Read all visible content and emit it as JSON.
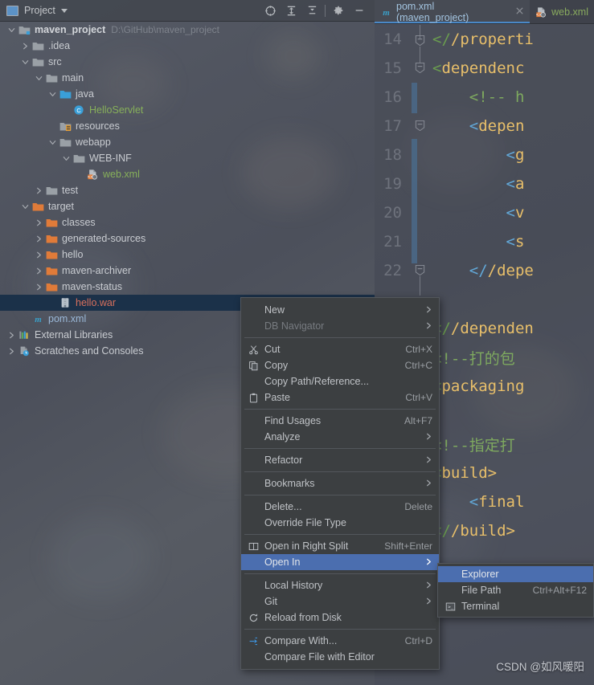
{
  "project_panel": {
    "header": {
      "title": "Project",
      "window_icon": "project-window-icon",
      "caret_icon": "chevron-down-icon",
      "toolbar": [
        {
          "name": "select-opened-file-icon",
          "label": "Select Opened File"
        },
        {
          "name": "expand-all-icon",
          "label": "Expand All"
        },
        {
          "name": "collapse-all-icon",
          "label": "Collapse All"
        },
        {
          "name": "gear-icon",
          "label": "Options"
        },
        {
          "name": "minimize-icon",
          "label": "Hide"
        }
      ]
    },
    "tree": [
      {
        "label": "maven_project",
        "hint": "D:\\GitHub\\maven_project",
        "indent": 0,
        "arrow": "down",
        "icon": "module-folder-icon",
        "style": "bold",
        "selected": false
      },
      {
        "label": ".idea",
        "hint": "",
        "indent": 1,
        "arrow": "right",
        "icon": "folder-icon",
        "style": "plain",
        "selected": false
      },
      {
        "label": "src",
        "hint": "",
        "indent": 1,
        "arrow": "down",
        "icon": "folder-icon",
        "style": "plain",
        "selected": false
      },
      {
        "label": "main",
        "hint": "",
        "indent": 2,
        "arrow": "down",
        "icon": "folder-icon",
        "style": "plain",
        "selected": false
      },
      {
        "label": "java",
        "hint": "",
        "indent": 3,
        "arrow": "down",
        "icon": "sources-folder-icon",
        "style": "plain",
        "selected": false
      },
      {
        "label": "HelloServlet",
        "hint": "",
        "indent": 4,
        "arrow": "none",
        "icon": "java-class-icon",
        "style": "green",
        "selected": false
      },
      {
        "label": "resources",
        "hint": "",
        "indent": 3,
        "arrow": "none",
        "icon": "resources-folder-icon",
        "style": "plain",
        "selected": false
      },
      {
        "label": "webapp",
        "hint": "",
        "indent": 3,
        "arrow": "down",
        "icon": "folder-icon",
        "style": "plain",
        "selected": false
      },
      {
        "label": "WEB-INF",
        "hint": "",
        "indent": 4,
        "arrow": "down",
        "icon": "folder-icon",
        "style": "plain",
        "selected": false
      },
      {
        "label": "web.xml",
        "hint": "",
        "indent": 5,
        "arrow": "none",
        "icon": "web-xml-icon",
        "style": "green",
        "selected": false
      },
      {
        "label": "test",
        "hint": "",
        "indent": 2,
        "arrow": "right",
        "icon": "folder-icon",
        "style": "plain",
        "selected": false
      },
      {
        "label": "target",
        "hint": "",
        "indent": 1,
        "arrow": "down",
        "icon": "excluded-folder-icon",
        "style": "plain",
        "selected": false
      },
      {
        "label": "classes",
        "hint": "",
        "indent": 2,
        "arrow": "right",
        "icon": "excluded-folder-icon",
        "style": "plain",
        "selected": false
      },
      {
        "label": "generated-sources",
        "hint": "",
        "indent": 2,
        "arrow": "right",
        "icon": "excluded-folder-icon",
        "style": "plain",
        "selected": false
      },
      {
        "label": "hello",
        "hint": "",
        "indent": 2,
        "arrow": "right",
        "icon": "excluded-folder-icon",
        "style": "plain",
        "selected": false
      },
      {
        "label": "maven-archiver",
        "hint": "",
        "indent": 2,
        "arrow": "right",
        "icon": "excluded-folder-icon",
        "style": "plain",
        "selected": false
      },
      {
        "label": "maven-status",
        "hint": "",
        "indent": 2,
        "arrow": "right",
        "icon": "excluded-folder-icon",
        "style": "plain",
        "selected": false
      },
      {
        "label": "hello.war",
        "hint": "",
        "indent": 3,
        "arrow": "none",
        "icon": "archive-icon",
        "style": "orange-red",
        "selected": true
      },
      {
        "label": "pom.xml",
        "hint": "",
        "indent": 1,
        "arrow": "none",
        "icon": "maven-icon",
        "style": "blue",
        "selected": false
      },
      {
        "label": "External Libraries",
        "hint": "",
        "indent": 0,
        "arrow": "right",
        "icon": "libraries-icon",
        "style": "plain",
        "selected": false
      },
      {
        "label": "Scratches and Consoles",
        "hint": "",
        "indent": 0,
        "arrow": "right",
        "icon": "scratches-icon",
        "style": "plain",
        "selected": false
      }
    ]
  },
  "editor": {
    "tabs": [
      {
        "label": "pom.xml (maven_project)",
        "icon": "maven-icon",
        "active": true,
        "closable": true,
        "close_icon": "close-icon",
        "style": "blue"
      },
      {
        "label": "web.xml",
        "icon": "web-xml-icon",
        "active": false,
        "closable": false,
        "close_icon": "",
        "style": "green"
      }
    ],
    "lines": [
      {
        "num": "14",
        "text": "</properti"
      },
      {
        "num": "15",
        "text": "<dependenc"
      },
      {
        "num": "16",
        "text": "    <!-- h"
      },
      {
        "num": "17",
        "text": "    <depen"
      },
      {
        "num": "18",
        "text": "        <g"
      },
      {
        "num": "19",
        "text": "        <a"
      },
      {
        "num": "20",
        "text": "        <v"
      },
      {
        "num": "21",
        "text": "        <s"
      },
      {
        "num": "22",
        "text": "    </depe"
      },
      {
        "num": "",
        "text": ""
      },
      {
        "num": "",
        "text": "</dependen"
      },
      {
        "num": "",
        "text": "<!--打的包"
      },
      {
        "num": "",
        "text": "<packaging"
      },
      {
        "num": "",
        "text": ""
      },
      {
        "num": "",
        "text": "<!--指定打"
      },
      {
        "num": "",
        "text": "<build>"
      },
      {
        "num": "",
        "text": "    <final"
      },
      {
        "num": "",
        "text": "</build>"
      }
    ]
  },
  "context_menu": {
    "items": [
      {
        "label": "New",
        "mnemonic": "",
        "accel": "",
        "icon": "",
        "submenu": true,
        "disabled": false,
        "highlighted": false
      },
      {
        "label": "DB Navigator",
        "mnemonic": "",
        "accel": "",
        "icon": "",
        "submenu": true,
        "disabled": true,
        "highlighted": false
      },
      {
        "separator": true
      },
      {
        "label": "Cut",
        "mnemonic": "t",
        "accel": "Ctrl+X",
        "icon": "cut-icon",
        "submenu": false,
        "disabled": false,
        "highlighted": false
      },
      {
        "label": "Copy",
        "mnemonic": "C",
        "accel": "Ctrl+C",
        "icon": "copy-icon",
        "submenu": false,
        "disabled": false,
        "highlighted": false
      },
      {
        "label": "Copy Path/Reference...",
        "mnemonic": "",
        "accel": "",
        "icon": "",
        "submenu": false,
        "disabled": false,
        "highlighted": false
      },
      {
        "label": "Paste",
        "mnemonic": "P",
        "accel": "Ctrl+V",
        "icon": "paste-icon",
        "submenu": false,
        "disabled": false,
        "highlighted": false
      },
      {
        "separator": true
      },
      {
        "label": "Find Usages",
        "mnemonic": "U",
        "accel": "Alt+F7",
        "icon": "",
        "submenu": false,
        "disabled": false,
        "highlighted": false
      },
      {
        "label": "Analyze",
        "mnemonic": "z",
        "accel": "",
        "icon": "",
        "submenu": true,
        "disabled": false,
        "highlighted": false
      },
      {
        "separator": true
      },
      {
        "label": "Refactor",
        "mnemonic": "R",
        "accel": "",
        "icon": "",
        "submenu": true,
        "disabled": false,
        "highlighted": false
      },
      {
        "separator": true
      },
      {
        "label": "Bookmarks",
        "mnemonic": "",
        "accel": "",
        "icon": "",
        "submenu": true,
        "disabled": false,
        "highlighted": false
      },
      {
        "separator": true
      },
      {
        "label": "Delete...",
        "mnemonic": "D",
        "accel": "Delete",
        "icon": "",
        "submenu": false,
        "disabled": false,
        "highlighted": false
      },
      {
        "label": "Override File Type",
        "mnemonic": "",
        "accel": "",
        "icon": "",
        "submenu": false,
        "disabled": false,
        "highlighted": false
      },
      {
        "separator": true
      },
      {
        "label": "Open in Right Split",
        "mnemonic": "",
        "accel": "Shift+Enter",
        "icon": "split-icon",
        "submenu": false,
        "disabled": false,
        "highlighted": false
      },
      {
        "label": "Open In",
        "mnemonic": "",
        "accel": "",
        "icon": "",
        "submenu": true,
        "disabled": false,
        "highlighted": true
      },
      {
        "separator": true
      },
      {
        "label": "Local History",
        "mnemonic": "H",
        "accel": "",
        "icon": "",
        "submenu": true,
        "disabled": false,
        "highlighted": false
      },
      {
        "label": "Git",
        "mnemonic": "G",
        "accel": "",
        "icon": "",
        "submenu": true,
        "disabled": false,
        "highlighted": false
      },
      {
        "label": "Reload from Disk",
        "mnemonic": "",
        "accel": "",
        "icon": "reload-icon",
        "submenu": false,
        "disabled": false,
        "highlighted": false
      },
      {
        "separator": true
      },
      {
        "label": "Compare With...",
        "mnemonic": "",
        "accel": "Ctrl+D",
        "icon": "compare-icon",
        "submenu": false,
        "disabled": false,
        "highlighted": false
      },
      {
        "label": "Compare File with Editor",
        "mnemonic": "m",
        "accel": "",
        "icon": "",
        "submenu": false,
        "disabled": false,
        "highlighted": false
      }
    ]
  },
  "context_submenu": {
    "items": [
      {
        "label": "Explorer",
        "mnemonic": "",
        "accel": "",
        "icon": "",
        "highlighted": true
      },
      {
        "label": "File Path",
        "mnemonic": "P",
        "accel": "Ctrl+Alt+F12",
        "icon": "",
        "highlighted": false
      },
      {
        "label": "Terminal",
        "mnemonic": "",
        "accel": "",
        "icon": "terminal-icon",
        "highlighted": false
      }
    ]
  },
  "watermark": {
    "text": "CSDN @如风暖阳"
  },
  "colors": {
    "selection_row": "#1b3149",
    "menu_highlight": "#4b6eaf",
    "menu_bg": "#3c3f41",
    "panel_bg": "#4e525c",
    "tab_underline": "#4a88c7",
    "folder_orange": "#e07b39",
    "folder_gray": "#9aa0a6",
    "sources_blue": "#3a9fd8",
    "text_green": "#87b05a",
    "text_tag": "#e8bf6a",
    "text_comment": "#7ea95f"
  }
}
